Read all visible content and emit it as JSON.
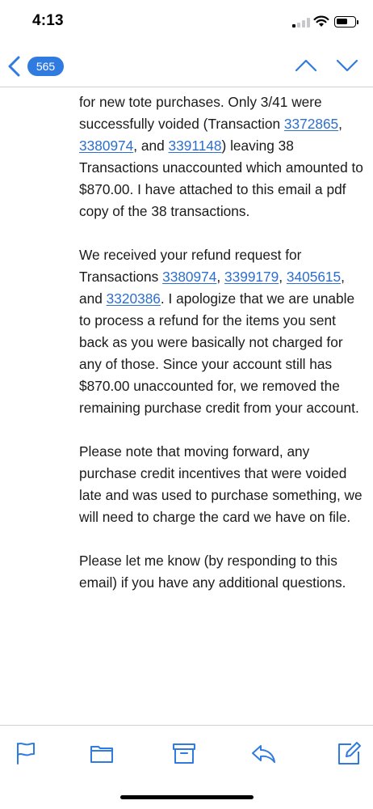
{
  "status_bar": {
    "time": "4:13",
    "signal_bars_filled": 1,
    "battery_level": 0.5
  },
  "nav": {
    "back_count": "565",
    "accent_color": "#2f7be0"
  },
  "email": {
    "p1": {
      "t1": "for new tote purchases. Only 3/41 were successfully voided (Transaction ",
      "l1": "3372865",
      "t2": ", ",
      "l2": "3380974",
      "t3": ", and ",
      "l3": "3391148",
      "t4": ") leaving 38 Transactions unaccounted which amounted to $870.00. I have attached to this email a pdf copy of the 38 transactions."
    },
    "p2": {
      "t1": "We received your refund request for Transactions ",
      "l1": "3380974",
      "t2": ", ",
      "l2": "3399179",
      "t3": ", ",
      "l3": "3405615",
      "t4": ", and ",
      "l4": "3320386",
      "t5": ".  I apologize that we are unable to process a refund for the items you sent back as you were basically not charged for any of those. Since your account still has $870.00 unaccounted for, we removed the remaining purchase credit from your account."
    },
    "p3": "Please note that moving forward, any purchase credit incentives that were voided late and was used to purchase something, we will need to charge the card we have on file.",
    "p4": "Please let me know (by responding to this email) if you have any additional questions."
  },
  "toolbar": {
    "icons": [
      "flag-icon",
      "folder-icon",
      "archive-icon",
      "reply-icon",
      "compose-icon"
    ]
  }
}
